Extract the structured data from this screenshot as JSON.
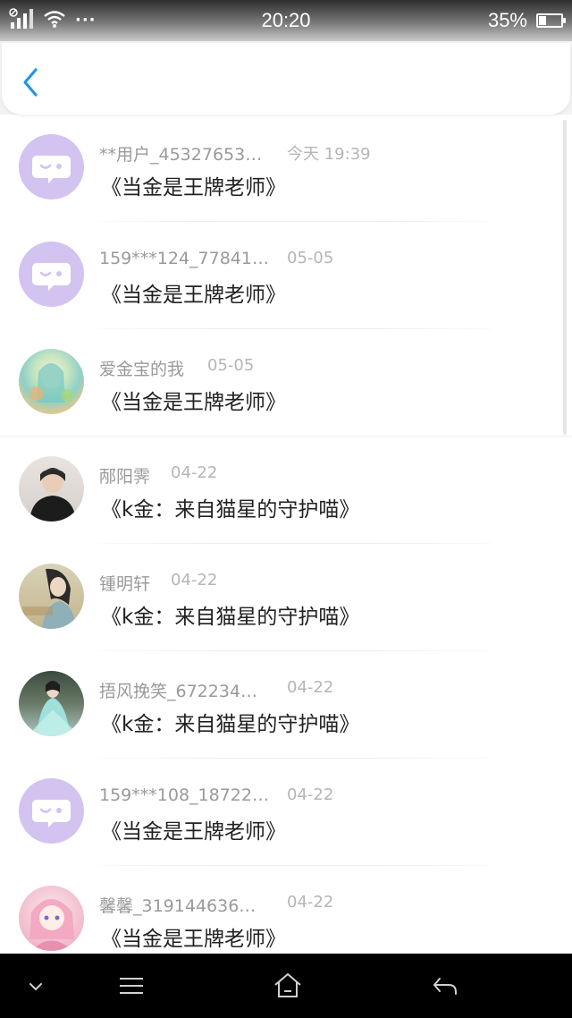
{
  "status_bar": {
    "time": "20:20",
    "battery_percent": "35%",
    "battery_level": 0.35,
    "more_dots": "···",
    "icons": [
      "signal-icon",
      "wifi-icon",
      "more-icon",
      "battery-icon"
    ]
  },
  "header": {
    "back_icon": "chevron-left-icon",
    "accent_color": "#2196e8"
  },
  "list": {
    "items": [
      {
        "name": "**用户_45327653…",
        "date": "今天 19:39",
        "title": "《当金是王牌老师》",
        "avatar": "default-avatar"
      },
      {
        "name": "159***124_77841…",
        "date": "05-05",
        "title": "《当金是王牌老师》",
        "avatar": "default-avatar"
      },
      {
        "name": "爱金宝的我",
        "date": "05-05",
        "title": "《当金是王牌老师》",
        "avatar": "photo-avatar"
      },
      {
        "name": "邴阳霁",
        "date": "04-22",
        "title": "《k金：来自猫星的守护喵》",
        "avatar": "photo-avatar"
      },
      {
        "name": "锺明轩",
        "date": "04-22",
        "title": "《k金：来自猫星的守护喵》",
        "avatar": "photo-avatar"
      },
      {
        "name": "捂风挽笑_672234…",
        "date": "04-22",
        "title": "《k金：来自猫星的守护喵》",
        "avatar": "photo-avatar"
      },
      {
        "name": "159***108_18722…",
        "date": "04-22",
        "title": "《当金是王牌老师》",
        "avatar": "default-avatar"
      },
      {
        "name": "馨馨_319144636…",
        "date": "04-22",
        "title": "《当金是王牌老师》",
        "avatar": "photo-avatar"
      }
    ]
  },
  "nav_bar": {
    "icons": [
      "chevron-down-icon",
      "menu-icon",
      "home-icon",
      "back-arrow-icon"
    ]
  },
  "colors": {
    "default_avatar_bg": "#d3c3f1",
    "name_text": "#9a9a9a",
    "date_text": "#b5b5b5",
    "title_text": "#222222"
  }
}
